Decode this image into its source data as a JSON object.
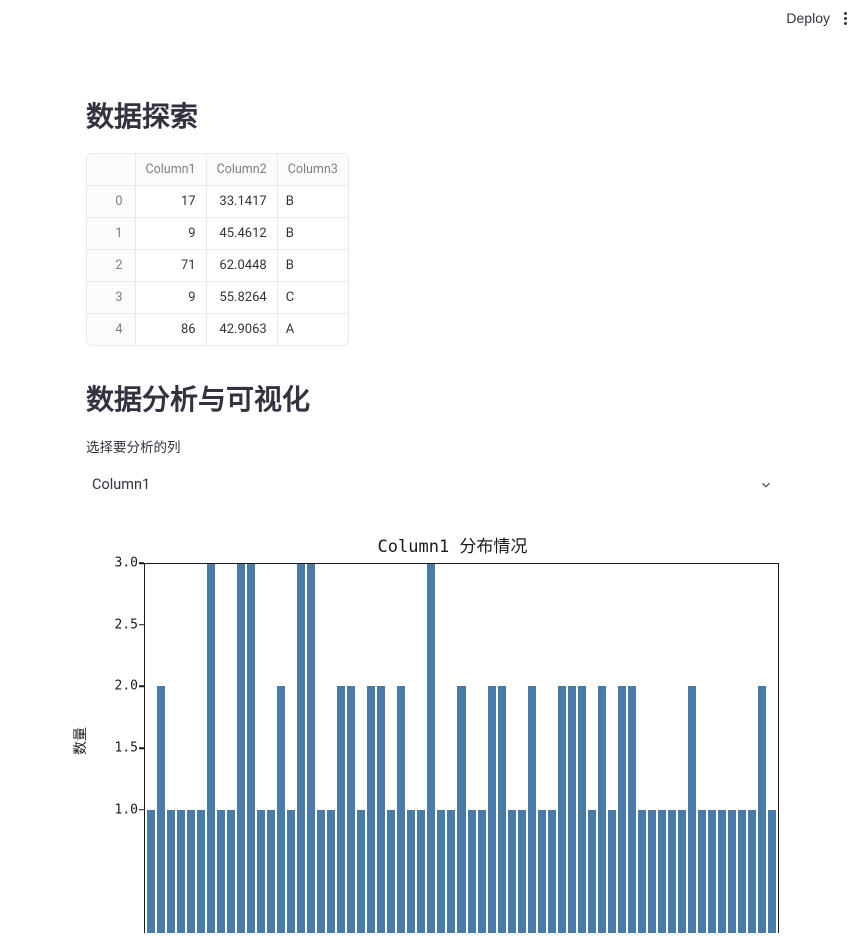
{
  "topbar": {
    "deploy_label": "Deploy"
  },
  "headings": {
    "explore": "数据探索",
    "analysis": "数据分析与可视化"
  },
  "table": {
    "headers": [
      "",
      "Column1",
      "Column2",
      "Column3"
    ],
    "rows": [
      [
        "0",
        "17",
        "33.1417",
        "B"
      ],
      [
        "1",
        "9",
        "45.4612",
        "B"
      ],
      [
        "2",
        "71",
        "62.0448",
        "B"
      ],
      [
        "3",
        "9",
        "55.8264",
        "C"
      ],
      [
        "4",
        "86",
        "42.9063",
        "A"
      ]
    ]
  },
  "select": {
    "label": "选择要分析的列",
    "value": "Column1"
  },
  "chart_data": {
    "type": "bar",
    "title": "Column1 分布情况",
    "ylabel": "数量",
    "ylim": [
      1.0,
      3.0
    ],
    "yticks": [
      1.0,
      1.5,
      2.0,
      2.5,
      3.0
    ],
    "values": [
      1,
      2,
      1,
      1,
      1,
      1,
      3,
      1,
      1,
      3,
      3,
      1,
      1,
      2,
      1,
      3,
      3,
      1,
      1,
      2,
      2,
      1,
      2,
      2,
      1,
      2,
      1,
      1,
      3,
      1,
      1,
      2,
      1,
      1,
      2,
      2,
      1,
      1,
      2,
      1,
      1,
      2,
      2,
      2,
      1,
      2,
      1,
      2,
      2,
      1,
      1,
      1,
      1,
      1,
      2,
      1,
      1,
      1,
      1,
      1,
      1,
      2,
      1
    ],
    "bar_color": "#4a7aa7"
  }
}
